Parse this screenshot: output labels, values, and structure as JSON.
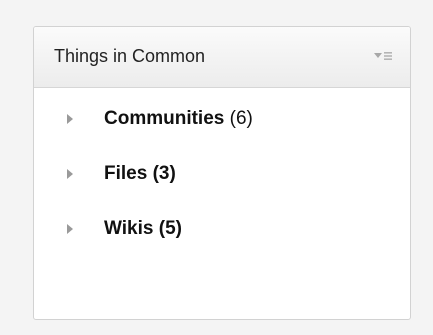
{
  "widget": {
    "title": "Things in Common",
    "menu_icon": "dropdown-menu-icon"
  },
  "items": [
    {
      "name": "Communities",
      "count": "(6)",
      "count_bold": false
    },
    {
      "name": "Files",
      "count": "(3)",
      "count_bold": true
    },
    {
      "name": "Wikis",
      "count": "(5)",
      "count_bold": true
    }
  ],
  "colors": {
    "header_bg": "#ececec",
    "border": "#d2d2d2",
    "twisty": "#9a9a9a",
    "text": "#111111"
  }
}
